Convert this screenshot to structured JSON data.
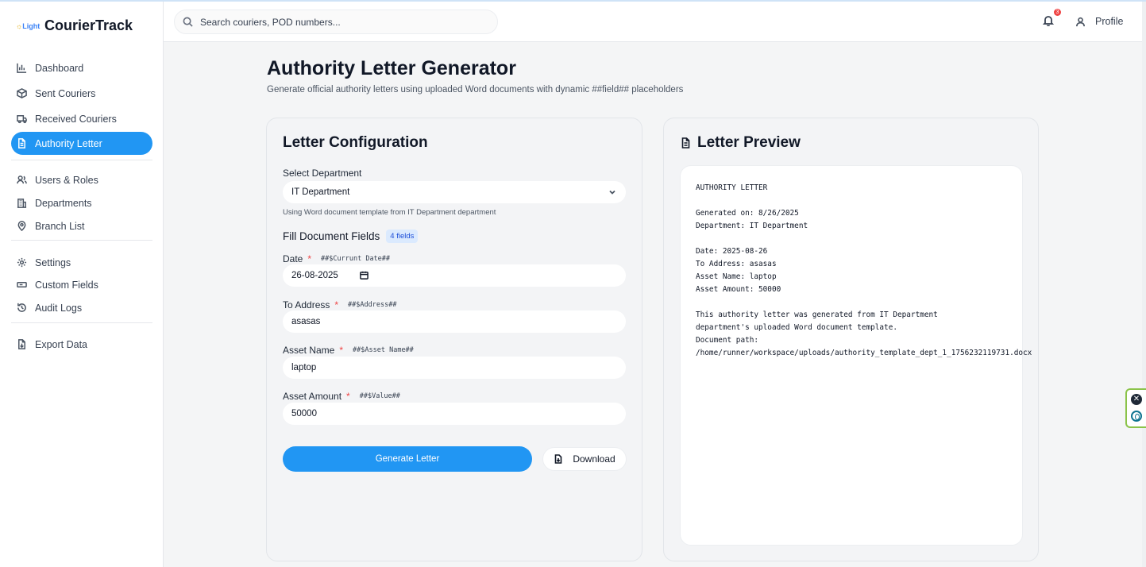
{
  "app": {
    "logo_text_a": "☼",
    "logo_text_b": "Light",
    "name": "CourierTrack"
  },
  "sidebar": {
    "items": [
      {
        "label": "Dashboard",
        "icon": "bar-chart-icon"
      },
      {
        "label": "Sent Couriers",
        "icon": "package-icon"
      },
      {
        "label": "Received Couriers",
        "icon": "truck-icon"
      },
      {
        "label": "Authority Letter",
        "icon": "file-text-icon",
        "active": true
      },
      {
        "label": "Users & Roles",
        "icon": "users-icon"
      },
      {
        "label": "Departments",
        "icon": "building-icon"
      },
      {
        "label": "Branch List",
        "icon": "map-pin-icon"
      },
      {
        "label": "Settings",
        "icon": "gear-icon"
      },
      {
        "label": "Custom Fields",
        "icon": "input-field-icon"
      },
      {
        "label": "Audit Logs",
        "icon": "history-icon"
      },
      {
        "label": "Export Data",
        "icon": "file-download-icon"
      }
    ]
  },
  "header": {
    "search_placeholder": "Search couriers, POD numbers...",
    "notification_count": "3",
    "profile_label": "Profile"
  },
  "page": {
    "title": "Authority Letter Generator",
    "subtitle": "Generate official authority letters using uploaded Word documents with dynamic ##field## placeholders"
  },
  "config": {
    "title": "Letter Configuration",
    "department_label": "Select Department",
    "department_value": "IT Department",
    "template_hint": "Using Word document template from IT Department department",
    "fields_title": "Fill Document Fields",
    "fields_badge": "4 fields",
    "fields": [
      {
        "label": "Date",
        "placeholder": "##$Currunt Date##",
        "value": "26-08-2025"
      },
      {
        "label": "To Address",
        "placeholder": "##$Address##",
        "value": "asasas"
      },
      {
        "label": "Asset Name",
        "placeholder": "##$Asset Name##",
        "value": "laptop"
      },
      {
        "label": "Asset Amount",
        "placeholder": "##$Value##",
        "value": "50000"
      }
    ],
    "required_mark": "*",
    "generate_label": "Generate Letter",
    "download_label": "Download"
  },
  "preview": {
    "title": "Letter Preview",
    "text": "AUTHORITY LETTER\n\nGenerated on: 8/26/2025\nDepartment: IT Department\n\nDate: 2025-08-26\nTo Address: asasas\nAsset Name: laptop\nAsset Amount: 50000\n\nThis authority letter was generated from IT Department\ndepartment's uploaded Word document template.\nDocument path:\n/home/runner/workspace/uploads/authority_template_dept_1_1756232119731.docx"
  },
  "widget": {
    "close_glyph": "✕"
  }
}
